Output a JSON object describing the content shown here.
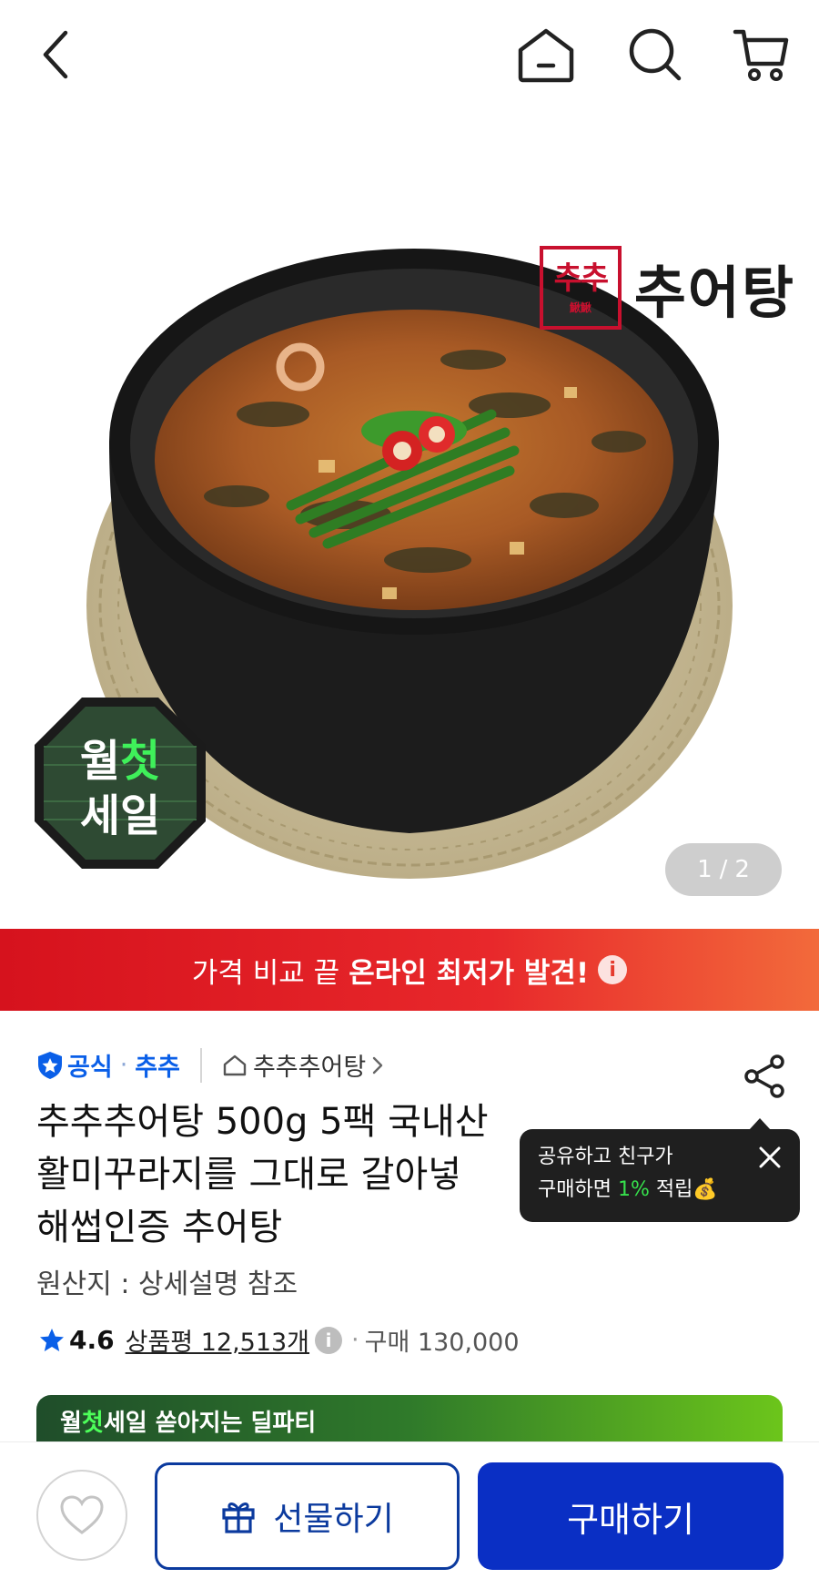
{
  "header": {
    "back_icon": "chevron-left-icon",
    "home_icon": "home-icon",
    "search_icon": "search-icon",
    "cart_icon": "cart-icon"
  },
  "hero": {
    "brand_seal_text": "추추",
    "brand_seal_small": "鰍鰍",
    "brand_name": "추어탕",
    "badge_line1_a": "월",
    "badge_line1_b": "첫",
    "badge_line2": "세일",
    "pager_current": "1",
    "pager_sep": "/",
    "pager_total": "2"
  },
  "banner": {
    "text_regular": "가격 비교 끝",
    "text_bold": "온라인 최저가 발견!",
    "info_icon": "i"
  },
  "seller": {
    "official_label": "공식",
    "brand_label": "추추",
    "store_label": "추추추어탕"
  },
  "product": {
    "title_line1": "추추추어탕 500g 5팩 국내산",
    "title_line2": "활미꾸라지를 그대로 갈아넣",
    "title_line3": "해썹인증 추어탕",
    "origin": "원산지 : 상세설명 참조",
    "rating": "4.6",
    "reviews": "상품평 12,513개",
    "info_icon": "i",
    "purchase": "구매 130,000"
  },
  "tooltip": {
    "line1": "공유하고 친구가",
    "line2_pre": "구매하면 ",
    "line2_pct": "1%",
    "line2_post": " 적립💰"
  },
  "sale_strip": {
    "a": "월",
    "b": "첫",
    "c": "세일",
    "d": " 쏟아지는 딜파티"
  },
  "bottom": {
    "gift_label": "선물하기",
    "buy_label": "구매하기"
  },
  "colors": {
    "primary": "#0a2fc4",
    "banner_red": "#d6121d",
    "official_blue": "#0a5fe8",
    "promo_green": "#36e04c"
  }
}
